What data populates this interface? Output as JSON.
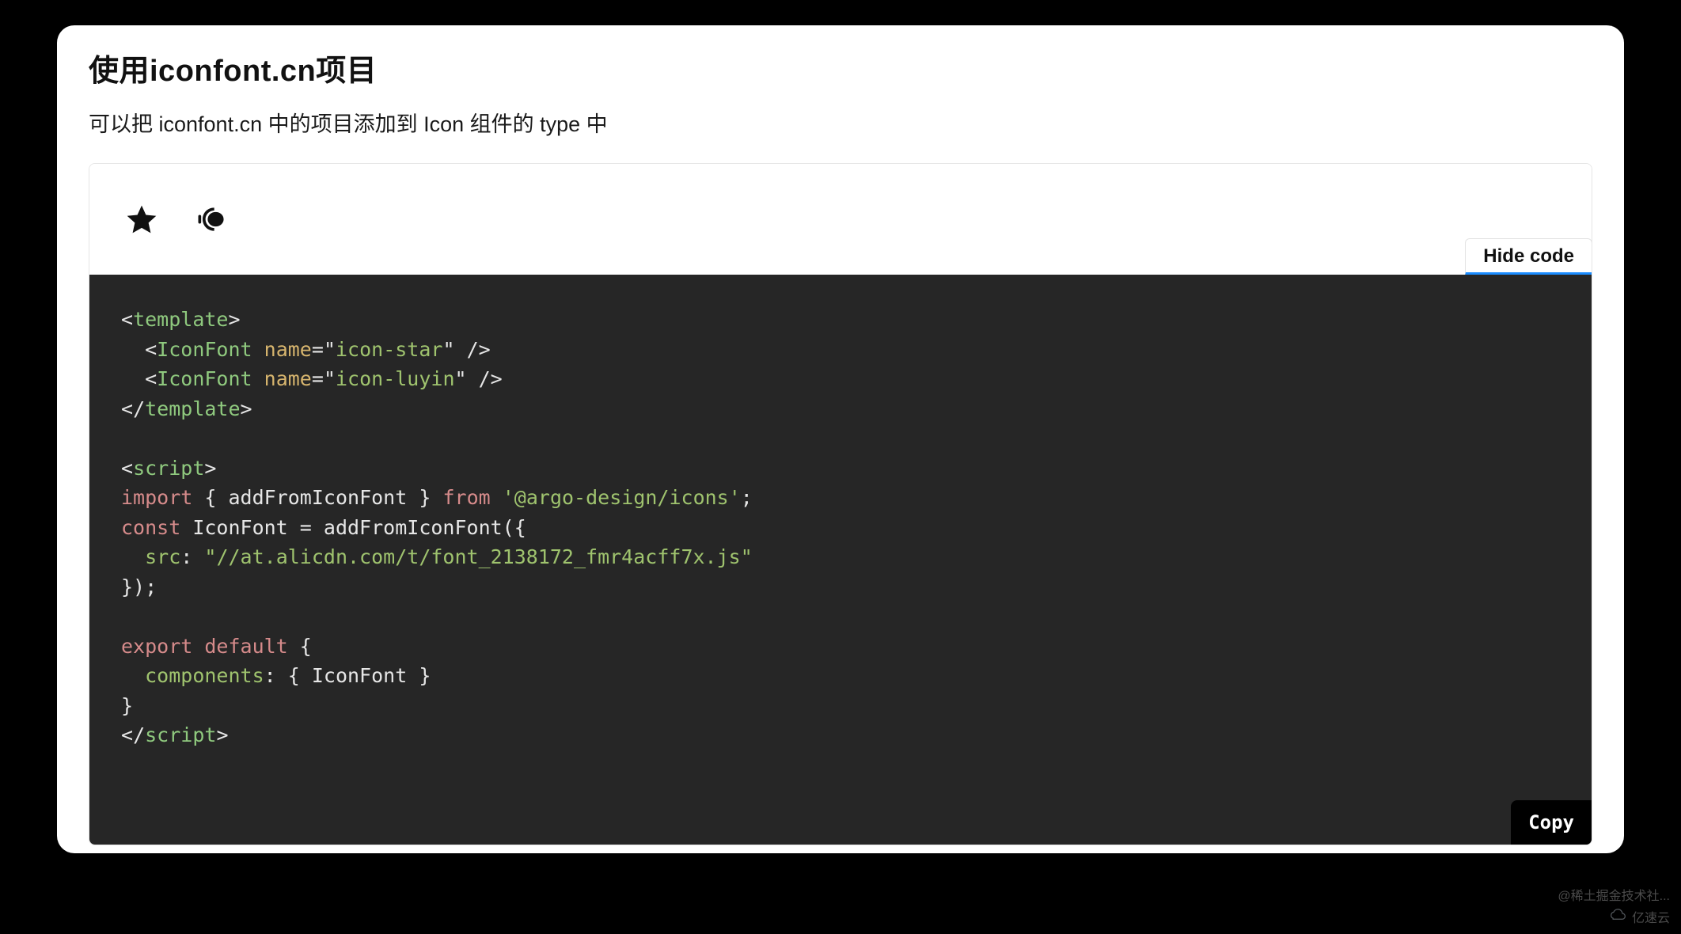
{
  "title": "使用iconfont.cn项目",
  "description": "可以把 iconfont.cn 中的项目添加到 Icon 组件的 type 中",
  "hide_code_label": "Hide code",
  "copy_label": "Copy",
  "icons": {
    "star_name": "icon-star",
    "luyin_name": "icon-luyin"
  },
  "code": {
    "lt": "<",
    "gt": ">",
    "slash": "/",
    "c_template": "template",
    "c_IconFont": "IconFont",
    "c_name_attr": "name",
    "c_eq": "=",
    "c_q": "\"",
    "c_icon_star": "icon-star",
    "c_icon_luyin": "icon-luyin",
    "c_script": "script",
    "c_import": "import",
    "c_lbrace": "{",
    "c_rbrace": "}",
    "c_addFromIconFont": "addFromIconFont",
    "c_from": "from",
    "c_pkg": "'@argo-design/icons'",
    "c_semi": ";",
    "c_const": "const",
    "c_IconFont2": "IconFont",
    "c_assign": " = ",
    "c_call_open": "addFromIconFont({",
    "c_src": "src",
    "c_colon": ":",
    "c_src_val": "\"//at.alicdn.com/t/font_2138172_fmr4acff7x.js\"",
    "c_call_close": "});",
    "c_export": "export",
    "c_default": "default",
    "c_components": "components",
    "c_comp_val": "{ IconFont }",
    "c_space": " ",
    "c_self_close": " />"
  },
  "watermark1": "@稀土掘金技术社...",
  "watermark2": "亿速云"
}
